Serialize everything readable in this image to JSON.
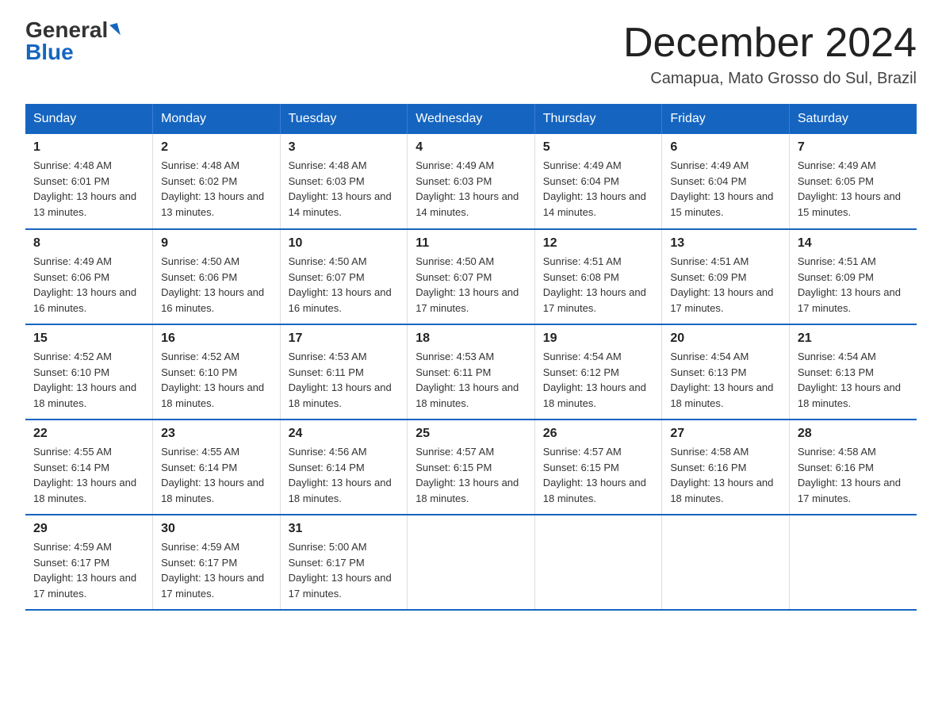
{
  "logo": {
    "general": "General",
    "blue": "Blue",
    "triangle": "▶"
  },
  "header": {
    "month": "December 2024",
    "location": "Camapua, Mato Grosso do Sul, Brazil"
  },
  "weekdays": [
    "Sunday",
    "Monday",
    "Tuesday",
    "Wednesday",
    "Thursday",
    "Friday",
    "Saturday"
  ],
  "weeks": [
    [
      {
        "day": "1",
        "sunrise": "4:48 AM",
        "sunset": "6:01 PM",
        "daylight": "13 hours and 13 minutes."
      },
      {
        "day": "2",
        "sunrise": "4:48 AM",
        "sunset": "6:02 PM",
        "daylight": "13 hours and 13 minutes."
      },
      {
        "day": "3",
        "sunrise": "4:48 AM",
        "sunset": "6:03 PM",
        "daylight": "13 hours and 14 minutes."
      },
      {
        "day": "4",
        "sunrise": "4:49 AM",
        "sunset": "6:03 PM",
        "daylight": "13 hours and 14 minutes."
      },
      {
        "day": "5",
        "sunrise": "4:49 AM",
        "sunset": "6:04 PM",
        "daylight": "13 hours and 14 minutes."
      },
      {
        "day": "6",
        "sunrise": "4:49 AM",
        "sunset": "6:04 PM",
        "daylight": "13 hours and 15 minutes."
      },
      {
        "day": "7",
        "sunrise": "4:49 AM",
        "sunset": "6:05 PM",
        "daylight": "13 hours and 15 minutes."
      }
    ],
    [
      {
        "day": "8",
        "sunrise": "4:49 AM",
        "sunset": "6:06 PM",
        "daylight": "13 hours and 16 minutes."
      },
      {
        "day": "9",
        "sunrise": "4:50 AM",
        "sunset": "6:06 PM",
        "daylight": "13 hours and 16 minutes."
      },
      {
        "day": "10",
        "sunrise": "4:50 AM",
        "sunset": "6:07 PM",
        "daylight": "13 hours and 16 minutes."
      },
      {
        "day": "11",
        "sunrise": "4:50 AM",
        "sunset": "6:07 PM",
        "daylight": "13 hours and 17 minutes."
      },
      {
        "day": "12",
        "sunrise": "4:51 AM",
        "sunset": "6:08 PM",
        "daylight": "13 hours and 17 minutes."
      },
      {
        "day": "13",
        "sunrise": "4:51 AM",
        "sunset": "6:09 PM",
        "daylight": "13 hours and 17 minutes."
      },
      {
        "day": "14",
        "sunrise": "4:51 AM",
        "sunset": "6:09 PM",
        "daylight": "13 hours and 17 minutes."
      }
    ],
    [
      {
        "day": "15",
        "sunrise": "4:52 AM",
        "sunset": "6:10 PM",
        "daylight": "13 hours and 18 minutes."
      },
      {
        "day": "16",
        "sunrise": "4:52 AM",
        "sunset": "6:10 PM",
        "daylight": "13 hours and 18 minutes."
      },
      {
        "day": "17",
        "sunrise": "4:53 AM",
        "sunset": "6:11 PM",
        "daylight": "13 hours and 18 minutes."
      },
      {
        "day": "18",
        "sunrise": "4:53 AM",
        "sunset": "6:11 PM",
        "daylight": "13 hours and 18 minutes."
      },
      {
        "day": "19",
        "sunrise": "4:54 AM",
        "sunset": "6:12 PM",
        "daylight": "13 hours and 18 minutes."
      },
      {
        "day": "20",
        "sunrise": "4:54 AM",
        "sunset": "6:13 PM",
        "daylight": "13 hours and 18 minutes."
      },
      {
        "day": "21",
        "sunrise": "4:54 AM",
        "sunset": "6:13 PM",
        "daylight": "13 hours and 18 minutes."
      }
    ],
    [
      {
        "day": "22",
        "sunrise": "4:55 AM",
        "sunset": "6:14 PM",
        "daylight": "13 hours and 18 minutes."
      },
      {
        "day": "23",
        "sunrise": "4:55 AM",
        "sunset": "6:14 PM",
        "daylight": "13 hours and 18 minutes."
      },
      {
        "day": "24",
        "sunrise": "4:56 AM",
        "sunset": "6:14 PM",
        "daylight": "13 hours and 18 minutes."
      },
      {
        "day": "25",
        "sunrise": "4:57 AM",
        "sunset": "6:15 PM",
        "daylight": "13 hours and 18 minutes."
      },
      {
        "day": "26",
        "sunrise": "4:57 AM",
        "sunset": "6:15 PM",
        "daylight": "13 hours and 18 minutes."
      },
      {
        "day": "27",
        "sunrise": "4:58 AM",
        "sunset": "6:16 PM",
        "daylight": "13 hours and 18 minutes."
      },
      {
        "day": "28",
        "sunrise": "4:58 AM",
        "sunset": "6:16 PM",
        "daylight": "13 hours and 17 minutes."
      }
    ],
    [
      {
        "day": "29",
        "sunrise": "4:59 AM",
        "sunset": "6:17 PM",
        "daylight": "13 hours and 17 minutes."
      },
      {
        "day": "30",
        "sunrise": "4:59 AM",
        "sunset": "6:17 PM",
        "daylight": "13 hours and 17 minutes."
      },
      {
        "day": "31",
        "sunrise": "5:00 AM",
        "sunset": "6:17 PM",
        "daylight": "13 hours and 17 minutes."
      },
      null,
      null,
      null,
      null
    ]
  ]
}
